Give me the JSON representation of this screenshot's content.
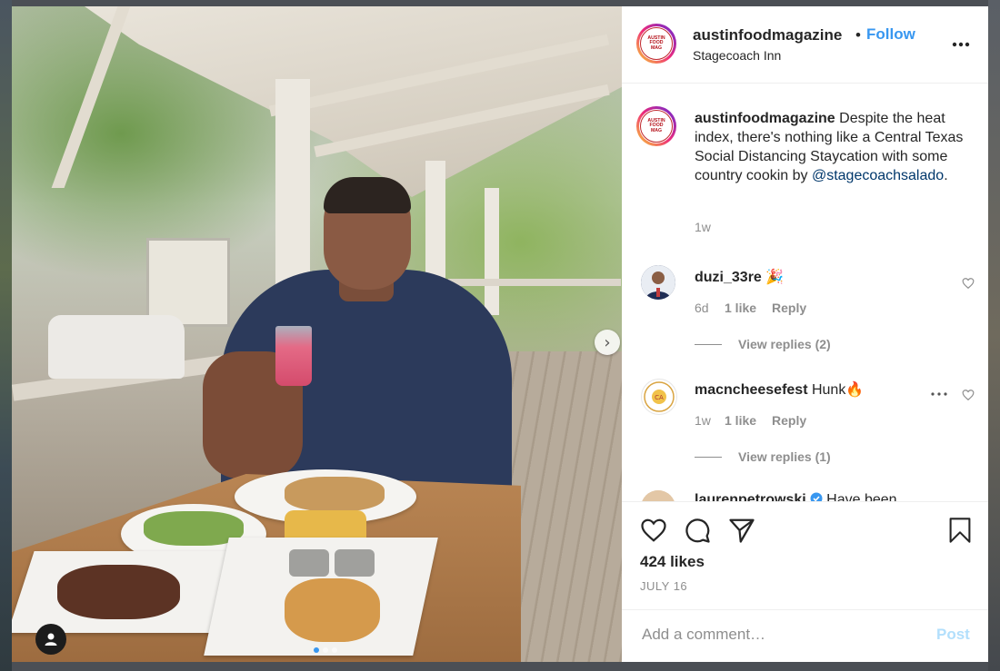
{
  "post": {
    "username": "austinfoodmagazine",
    "separator": "•",
    "follow_label": "Follow",
    "location": "Stagecoach Inn",
    "more_label": "•••",
    "avatar_text": [
      "AUSTIN",
      "FOOD",
      "MAG"
    ]
  },
  "caption": {
    "username": "austinfoodmagazine",
    "text": " Despite the heat index, there's nothing like a Central Texas Social Distancing Staycation with some country cookin by ",
    "mention": "@stagecoachsalado",
    "end": ".",
    "time": "1w"
  },
  "comments": [
    {
      "username": "duzi_33re",
      "text": " 🎉",
      "time": "6d",
      "likes": "1 like",
      "reply_label": "Reply",
      "view_replies": "View replies (2)"
    },
    {
      "username": "macncheesefest",
      "text": " Hunk🔥",
      "time": "1w",
      "likes": "1 like",
      "reply_label": "Reply",
      "view_replies": "View replies (1)",
      "more_label": "•••"
    },
    {
      "username": "laurenpetrowski",
      "text": " Have been"
    }
  ],
  "actions": {
    "like_icon": "heart-icon",
    "comment_icon": "comment-icon",
    "share_icon": "paper-plane-icon",
    "save_icon": "bookmark-icon",
    "likes_text": "424 likes",
    "date_text": "JULY 16"
  },
  "add_comment": {
    "placeholder": "Add a comment…",
    "post_label": "Post"
  },
  "carousel": {
    "next_arrow": "›",
    "total_slides": 3,
    "active_slide": 1
  },
  "colors": {
    "accent": "#3897f0",
    "text": "#262626",
    "muted": "#8e8e8e",
    "post_disabled": "#b2dffc"
  }
}
